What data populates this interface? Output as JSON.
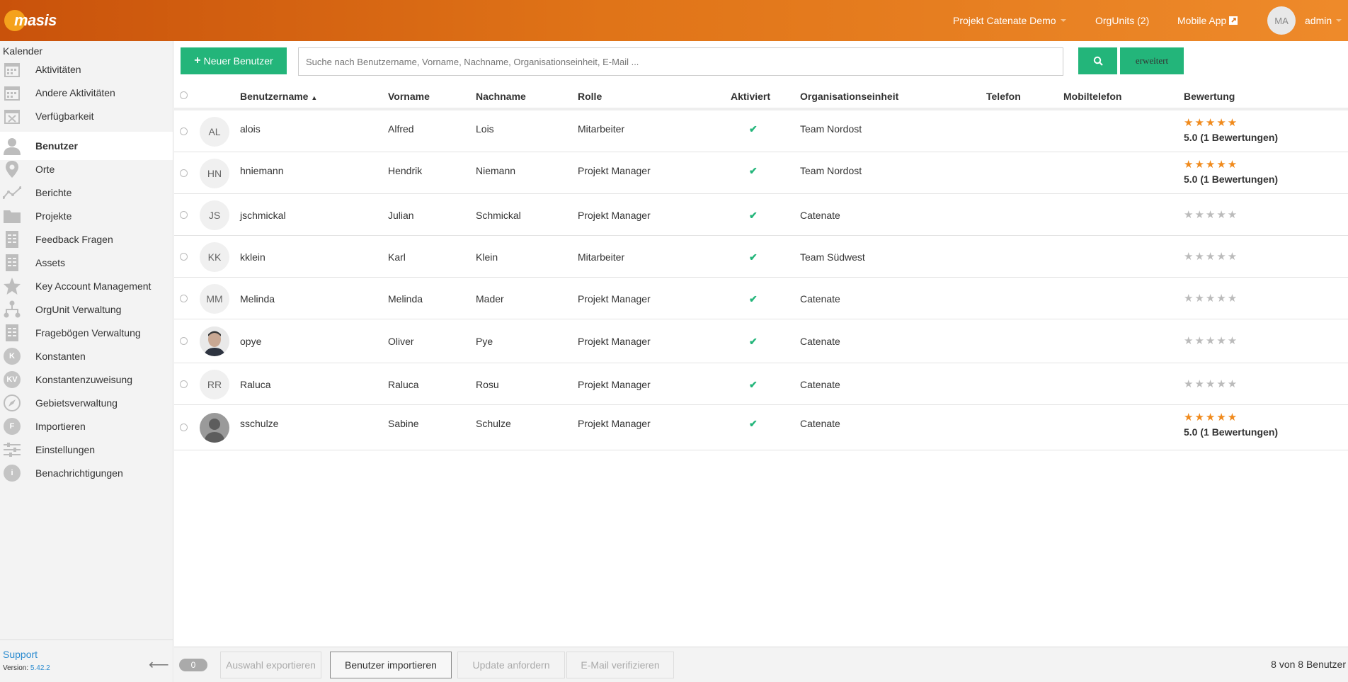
{
  "header": {
    "logo_text": "masis",
    "project": "Projekt Catenate Demo",
    "orgunits": "OrgUnits (2)",
    "mobile_app": "Mobile App",
    "user_initials": "MA",
    "user_name": "admin"
  },
  "sidebar": {
    "heading": "Kalender",
    "items": [
      {
        "label": "Aktivitäten",
        "icon": "calendar-icon"
      },
      {
        "label": "Andere Aktivitäten",
        "icon": "calendar-icon"
      },
      {
        "label": "Verfügbarkeit",
        "icon": "calendar-x-icon"
      },
      {
        "label": "Benutzer",
        "icon": "user-icon",
        "active": true
      },
      {
        "label": "Orte",
        "icon": "map-pin-icon"
      },
      {
        "label": "Berichte",
        "icon": "line-chart-icon"
      },
      {
        "label": "Projekte",
        "icon": "folder-icon"
      },
      {
        "label": "Feedback Fragen",
        "icon": "document-icon"
      },
      {
        "label": "Assets",
        "icon": "document-icon"
      },
      {
        "label": "Key Account Management",
        "icon": "star-icon"
      },
      {
        "label": "OrgUnit Verwaltung",
        "icon": "hierarchy-icon"
      },
      {
        "label": "Fragebögen Verwaltung",
        "icon": "document-icon"
      },
      {
        "label": "Konstanten",
        "icon": "k-circle-icon",
        "badge": "K"
      },
      {
        "label": "Konstantenzuweisung",
        "icon": "kv-circle-icon",
        "badge": "KV"
      },
      {
        "label": "Gebietsverwaltung",
        "icon": "compass-icon"
      },
      {
        "label": "Importieren",
        "icon": "f-circle-icon",
        "badge": "F"
      },
      {
        "label": "Einstellungen",
        "icon": "sliders-icon"
      },
      {
        "label": "Benachrichtigungen",
        "icon": "info-icon",
        "badge": "i"
      }
    ],
    "support": "Support",
    "version_label": "Version:",
    "version": "5.42.2"
  },
  "toolbar": {
    "new_user": "Neuer Benutzer",
    "search_placeholder": "Suche nach Benutzername, Vorname, Nachname, Organisationseinheit, E-Mail ...",
    "advanced": "erweitert"
  },
  "table": {
    "columns": {
      "username": "Benutzername",
      "firstname": "Vorname",
      "lastname": "Nachname",
      "role": "Rolle",
      "activated": "Aktiviert",
      "orgunit": "Organisationseinheit",
      "phone": "Telefon",
      "mobile": "Mobiltelefon",
      "rating": "Bewertung"
    },
    "rows": [
      {
        "initials": "AL",
        "username": "alois",
        "firstname": "Alfred",
        "lastname": "Lois",
        "role": "Mitarbeiter",
        "orgunit": "Team Nordost",
        "rated": true,
        "rating_text": "5.0 (1 Bewertungen)"
      },
      {
        "initials": "HN",
        "username": "hniemann",
        "firstname": "Hendrik",
        "lastname": "Niemann",
        "role": "Projekt Manager",
        "orgunit": "Team Nordost",
        "rated": true,
        "rating_text": "5.0 (1 Bewertungen)"
      },
      {
        "initials": "JS",
        "username": "jschmickal",
        "firstname": "Julian",
        "lastname": "Schmickal",
        "role": "Projekt Manager",
        "orgunit": "Catenate",
        "rated": false,
        "rating_text": ""
      },
      {
        "initials": "KK",
        "username": "kklein",
        "firstname": "Karl",
        "lastname": "Klein",
        "role": "Mitarbeiter",
        "orgunit": "Team Südwest",
        "rated": false,
        "rating_text": ""
      },
      {
        "initials": "MM",
        "username": "Melinda",
        "firstname": "Melinda",
        "lastname": "Mader",
        "role": "Projekt Manager",
        "orgunit": "Catenate",
        "rated": false,
        "rating_text": ""
      },
      {
        "initials": "",
        "photo": "photo",
        "username": "opye",
        "firstname": "Oliver",
        "lastname": "Pye",
        "role": "Projekt Manager",
        "orgunit": "Catenate",
        "rated": false,
        "rating_text": ""
      },
      {
        "initials": "RR",
        "username": "Raluca",
        "firstname": "Raluca",
        "lastname": "Rosu",
        "role": "Projekt Manager",
        "orgunit": "Catenate",
        "rated": false,
        "rating_text": ""
      },
      {
        "initials": "",
        "photo": "silhouette",
        "username": "sschulze",
        "firstname": "Sabine",
        "lastname": "Schulze",
        "role": "Projekt Manager",
        "orgunit": "Catenate",
        "rated": true,
        "rating_text": "5.0 (1 Bewertungen)"
      }
    ]
  },
  "footer": {
    "selected_count": "0",
    "export": "Auswahl exportieren",
    "import": "Benutzer importieren",
    "update": "Update anfordern",
    "verify": "E-Mail verifizieren",
    "total": "8 von 8 Benutzer"
  },
  "colors": {
    "accent_green": "#23b57a",
    "header_orange": "#e07418",
    "star_orange": "#f08a1c"
  }
}
